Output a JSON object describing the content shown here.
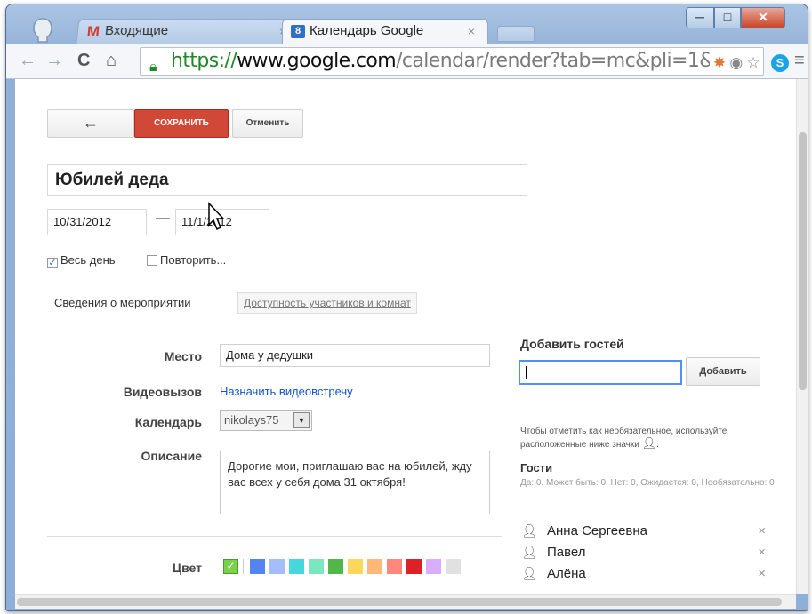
{
  "browser": {
    "tabs": [
      {
        "label": "Входящие",
        "icon": "gmail-icon",
        "active": false
      },
      {
        "label": "Календарь Google",
        "icon": "google-calendar-icon",
        "active": true
      }
    ],
    "tab_close_glyph": "×",
    "url": {
      "scheme": "https://",
      "host": "www.google.com",
      "path": "/calendar/render?tab=mc&pli=1&"
    },
    "window_controls": {
      "minimize": "─",
      "maximize": "□",
      "close": "✕"
    }
  },
  "toolbar": {
    "back_label": "←",
    "save_label": "СОХРАНИТЬ",
    "cancel_label": "Отменить"
  },
  "event": {
    "title": "Юбилей деда",
    "start_date": "10/31/2012",
    "date_separator": "—",
    "end_date": "11/1/2012",
    "all_day_label": "Весь день",
    "all_day_checked": true,
    "repeat_label": "Повторить...",
    "repeat_checked": false
  },
  "subtabs": {
    "details": "Сведения о мероприятии",
    "availability": "Доступность участников и комнат"
  },
  "form": {
    "location_label": "Место",
    "location_value": "Дома у дедушки",
    "video_label": "Видеовызов",
    "video_link": "Назначить видеовстречу",
    "calendar_label": "Календарь",
    "calendar_value": "nikolays75",
    "description_label": "Описание",
    "description_value": "Дорогие мои, приглашаю вас на юбилей, жду вас всех у себя дома 31 октября!",
    "color_label": "Цвет",
    "colors": [
      "#7bd148",
      "#5484ed",
      "#a4bdfc",
      "#46d6db",
      "#7ae7bf",
      "#51b749",
      "#fbd75b",
      "#ffb878",
      "#ff887c",
      "#dc2127",
      "#dbadff",
      "#e1e1e1"
    ]
  },
  "guests": {
    "add_heading": "Добавить гостей",
    "add_button": "Добавить",
    "optional_note": "Чтобы отметить как необязательное, используйте расположенные ниже значки",
    "guests_label": "Гости",
    "stats": "Да: 0, Может быть: 0, Нет: 0, Ожидается: 0, Необязательно: 0",
    "list": [
      {
        "name": "Анна Сергеевна"
      },
      {
        "name": "Павел"
      },
      {
        "name": "Алёна"
      }
    ],
    "remove_glyph": "×"
  }
}
